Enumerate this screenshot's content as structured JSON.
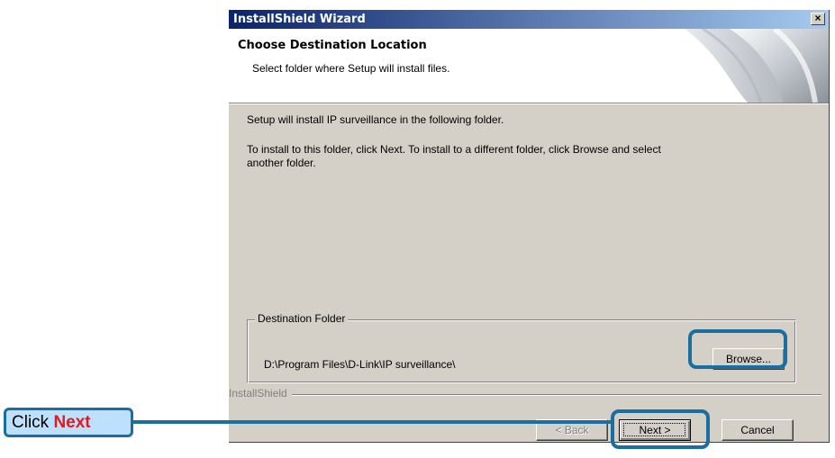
{
  "window": {
    "title": "InstallShield Wizard",
    "close_label": "×"
  },
  "header": {
    "title": "Choose Destination Location",
    "subtitle": "Select folder where Setup will install files."
  },
  "body": {
    "line1": "Setup will install IP surveillance in the following folder.",
    "line2": "To install to this folder, click Next. To install to a different folder, click Browse and select",
    "line3": "another folder."
  },
  "destination": {
    "group_label": "Destination Folder",
    "path": "D:\\Program Files\\D-Link\\IP surveillance\\",
    "browse_label": "Browse..."
  },
  "footer": {
    "brand": "InstallShield",
    "back_label": "< Back",
    "next_label": "Next >",
    "cancel_label": "Cancel"
  },
  "annotation": {
    "prefix": "Click",
    "emphasis": "Next"
  },
  "colors": {
    "title_gradient_start": "#0a246a",
    "title_gradient_end": "#a6caf0",
    "dialog_face": "#d4d0c8",
    "annotation_border": "#1a6fa0",
    "annotation_fill": "#bde0ff",
    "annotation_emphasis": "#e31a1a"
  },
  "icons": {
    "close": "close-icon",
    "header_art": "page-curl-icon"
  }
}
